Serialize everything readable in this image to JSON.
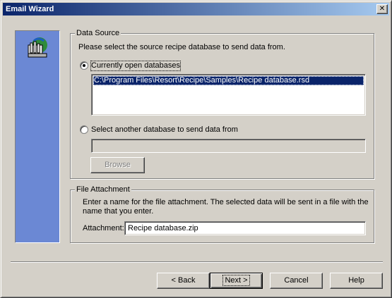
{
  "window": {
    "title": "Email Wizard",
    "close_glyph": "✕"
  },
  "sidebar": {
    "icon": "wizard-database-icon"
  },
  "data_source": {
    "legend": "Data Source",
    "instruction": "Please select the source recipe database to send data from.",
    "option_open": {
      "label": "Currently open databases",
      "selected": true
    },
    "open_databases": [
      "C:\\Program Files\\Resort\\Recipe\\Samples\\Recipe database.rsd"
    ],
    "option_other": {
      "label": "Select another database to send data from",
      "selected": false
    },
    "other_path": "",
    "browse_label": "Browse"
  },
  "file_attachment": {
    "legend": "File Attachment",
    "instruction": "Enter a name for the file attachment.  The selected data will be sent in a file with the name that you enter.",
    "attachment_label": "Attachment:",
    "attachment_value": "Recipe database.zip"
  },
  "buttons": {
    "back": "< Back",
    "next": "Next >",
    "cancel": "Cancel",
    "help": "Help"
  }
}
